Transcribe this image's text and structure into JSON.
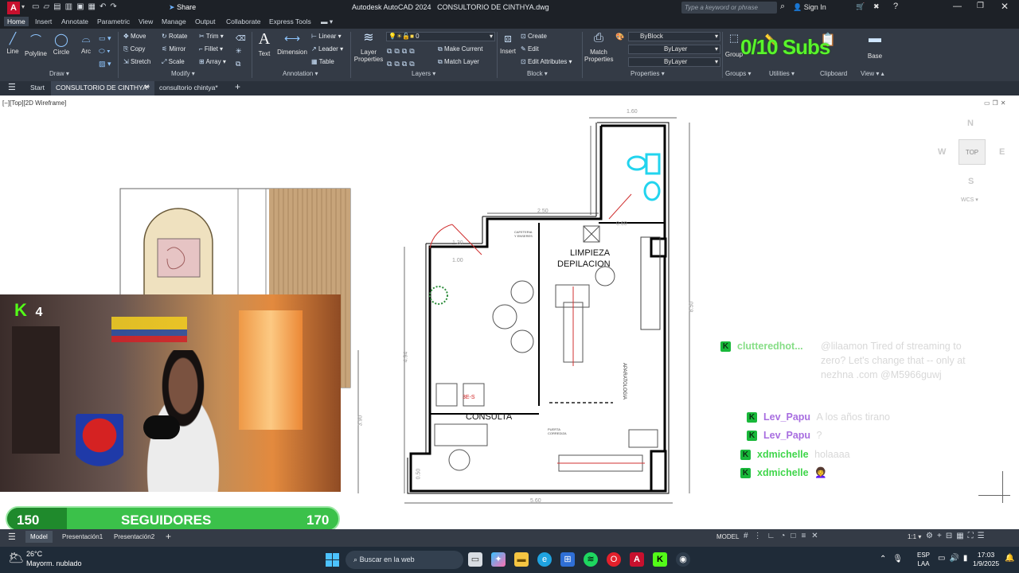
{
  "titlebar": {
    "app_title": "Autodesk AutoCAD 2024",
    "file_title": "CONSULTORIO DE CINTHYA.dwg",
    "share": "Share",
    "search_placeholder": "Type a keyword or phrase",
    "sign_in": "Sign In"
  },
  "menu_tabs": [
    "Home",
    "Insert",
    "Annotate",
    "Parametric",
    "View",
    "Manage",
    "Output",
    "Collaborate",
    "Express Tools"
  ],
  "ribbon": {
    "draw": {
      "line": "Line",
      "polyline": "Polyline",
      "circle": "Circle",
      "arc": "Arc",
      "group": "Draw"
    },
    "modify": {
      "move": "Move",
      "rotate": "Rotate",
      "trim": "Trim",
      "copy": "Copy",
      "mirror": "Mirror",
      "fillet": "Fillet",
      "stretch": "Stretch",
      "scale": "Scale",
      "array": "Array",
      "group": "Modify"
    },
    "annotation": {
      "text": "Text",
      "dimension": "Dimension",
      "linear": "Linear",
      "leader": "Leader",
      "table": "Table",
      "group": "Annotation"
    },
    "layers": {
      "layer_properties": "Layer Properties",
      "layer_value": "0",
      "make_current": "Make Current",
      "match_layer": "Match Layer",
      "group": "Layers"
    },
    "block": {
      "insert": "Insert",
      "create": "Create",
      "edit": "Edit",
      "edit_attributes": "Edit Attributes",
      "group": "Block"
    },
    "properties": {
      "match_properties": "Match Properties",
      "byblock": "ByBlock",
      "bylayer1": "ByLayer",
      "bylayer2": "ByLayer",
      "group": "Properties"
    },
    "groups": {
      "group": "Groups",
      "btn": "Group"
    },
    "utilities": {
      "group": "Utilities"
    },
    "clipboard": {
      "group": "Clipboard"
    },
    "view": {
      "base": "Base",
      "group": "View"
    }
  },
  "doc_tabs": {
    "start": "Start",
    "active": "CONSULTORIO DE CINTHYA*",
    "second": "consultorio chintya*"
  },
  "viewport": {
    "label": "[−][Top][2D Wireframe]",
    "viewcube": {
      "n": "N",
      "s": "S",
      "e": "E",
      "w": "W",
      "top": "TOP",
      "wcs": "WCS"
    }
  },
  "drawing": {
    "room_limpieza_1": "LIMPIEZA",
    "room_limpieza_2": "DEPILACION",
    "room_consulta": "CONSULTA",
    "aparatologia": "APARATOLOGIA",
    "dims": {
      "top": "1.60",
      "mid": "2.50",
      "right_small": "0.60",
      "d130": "1.30",
      "d100": "1.00",
      "bottom": "5.60",
      "right_total": "8.50",
      "left_a": "4.94",
      "left_b": "3.90",
      "left_c": "0.50"
    },
    "small_texts": {
      "cafeteria": "CAFETERIA Y ENSERES",
      "puerta": "PUERTA CORREDIZA",
      "label_s": "3E-S"
    }
  },
  "overlay": {
    "subs_goal": "0/10 Subs",
    "kick_viewers": "4",
    "followers_label": "SEGUIDORES",
    "followers_current": "150",
    "followers_goal": "170",
    "followers_progress": 0.18
  },
  "chat": [
    {
      "user": "clutteredhot...",
      "message": "@lilaamon Tired of streaming to zero? Let's change that -- only at nezhna .com @M5966guwj",
      "color": "#5fd35f"
    },
    {
      "user": "Lev_Papu",
      "message": "A los años tirano",
      "color": "#a86ee0"
    },
    {
      "user": "Lev_Papu",
      "message": "?",
      "color": "#a86ee0"
    },
    {
      "user": "xdmichelle",
      "message": "holaaaa",
      "color": "#3fd64a"
    },
    {
      "user": "xdmichelle",
      "message": "👩‍🦱",
      "color": "#3fd64a"
    }
  ],
  "layout_tabs": {
    "model": "Model",
    "p1": "Presentación1",
    "p2": "Presentación2"
  },
  "status": {
    "model": "MODEL",
    "scale": "1:1"
  },
  "taskbar": {
    "weather_temp": "26°C",
    "weather_desc": "Mayorm. nublado",
    "search": "Buscar en la web",
    "lang1": "ESP",
    "lang2": "LAA",
    "time": "17:03",
    "date": "1/9/2025"
  }
}
